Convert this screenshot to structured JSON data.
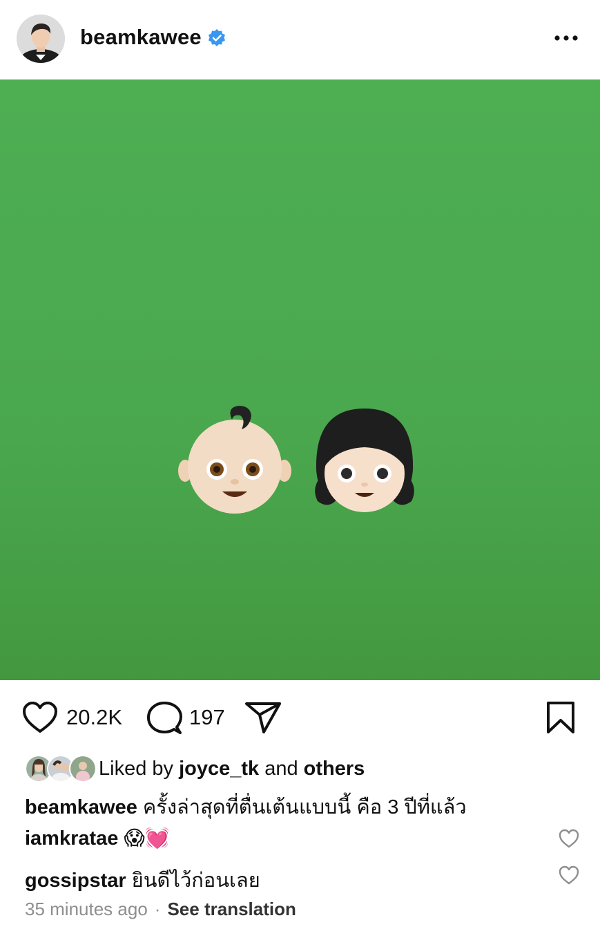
{
  "header": {
    "username": "beamkawee",
    "verified_icon": "verified-badge-icon",
    "more_icon": "more-options-icon"
  },
  "post": {
    "background_color": "#4eae52",
    "emojis": [
      "baby-emoji",
      "girl-emoji"
    ]
  },
  "actions": {
    "like_icon": "heart-icon",
    "like_count": "20.2K",
    "comment_icon": "comment-icon",
    "comment_count": "197",
    "share_icon": "send-icon",
    "save_icon": "bookmark-icon"
  },
  "likes": {
    "prefix": "Liked by ",
    "user": "joyce_tk",
    "middle": " and ",
    "others": "others"
  },
  "caption": {
    "user": "beamkawee",
    "text": "ครั้งล่าสุดที่ตื่นเต้นแบบนี้ คือ 3 ปีที่แล้ว"
  },
  "comments": [
    {
      "user": "iamkratae",
      "text": "😱💓"
    },
    {
      "user": "gossipstar",
      "text": "ยินดีไว้ก่อนเลย"
    }
  ],
  "meta": {
    "time": "35 minutes ago",
    "separator": "·",
    "translate": "See translation"
  }
}
